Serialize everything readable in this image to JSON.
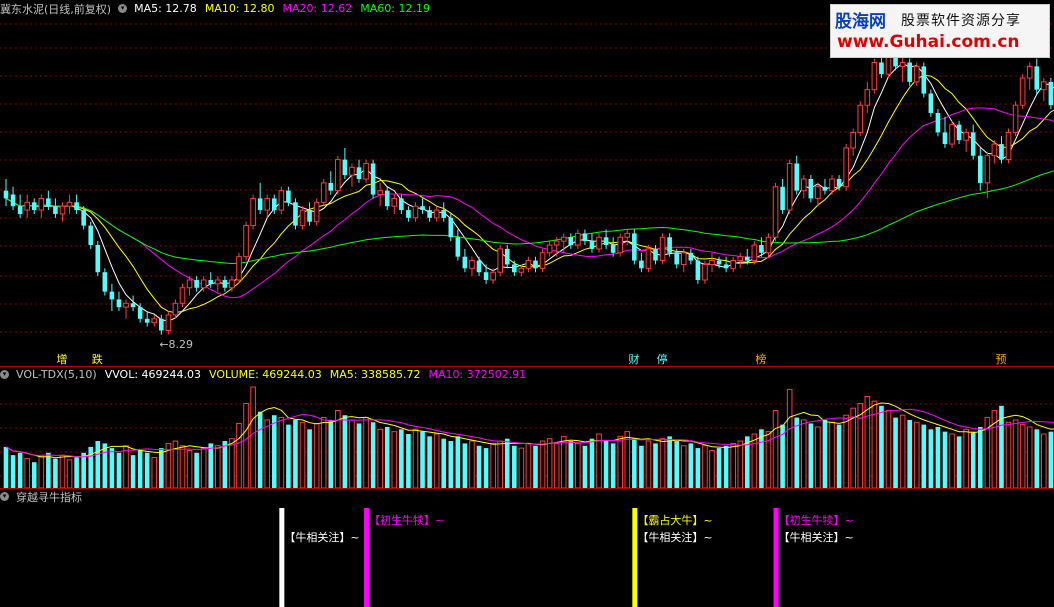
{
  "main_panel": {
    "title": "冀东水泥(日线,前复权)",
    "ma_labels": [
      {
        "text": "MA5: 12.78",
        "color": "#ffffff"
      },
      {
        "text": "MA10: 12.80",
        "color": "#ffff00"
      },
      {
        "text": "MA20: 12.62",
        "color": "#ff00ff"
      },
      {
        "text": "MA60: 12.19",
        "color": "#00ff00"
      }
    ],
    "low_annotation": "8.29",
    "events": [
      {
        "text": "增",
        "color": "#ffff00",
        "candle": 8
      },
      {
        "text": "跌",
        "color": "#ffff00",
        "candle": 13
      },
      {
        "text": "财",
        "color": "#54fcfc",
        "candle": 89
      },
      {
        "text": "停",
        "color": "#54fcfc",
        "candle": 93
      },
      {
        "text": "榜",
        "color": "#ffa500",
        "candle": 107
      },
      {
        "text": "预",
        "color": "#ffa500",
        "candle": 141
      }
    ]
  },
  "volume_panel": {
    "labels": [
      {
        "text": "VOL-TDX(5,10)",
        "color": "#c0c0c0"
      },
      {
        "text": "VVOL: 469244.03",
        "color": "#ffffff"
      },
      {
        "text": "VOLUME: 469244.03",
        "color": "#ffff00"
      },
      {
        "text": "MA5: 338585.72",
        "color": "#ffff00"
      },
      {
        "text": "MA10: 372502.91",
        "color": "#ff00ff"
      }
    ]
  },
  "signal_panel": {
    "title": "穿越寻牛指标",
    "signals": [
      {
        "candle": 39,
        "color": "#ffffff",
        "labels": [
          {
            "text": "【牛相关注】~",
            "color": "#ffffff",
            "row": 1
          }
        ]
      },
      {
        "candle": 51,
        "color": "#ff00ff",
        "labels": [
          {
            "text": "【初生牛犊】~",
            "color": "#ff00ff",
            "row": 0
          }
        ]
      },
      {
        "candle": 89,
        "color": "#ffff00",
        "labels": [
          {
            "text": "【霸占大牛】~",
            "color": "#ffff00",
            "row": 0
          },
          {
            "text": "【牛相关注】~",
            "color": "#ffffff",
            "row": 1
          }
        ]
      },
      {
        "candle": 109,
        "color": "#ff00ff",
        "labels": [
          {
            "text": "【初生牛犊】~",
            "color": "#ff00ff",
            "row": 0
          },
          {
            "text": "【牛相关注】~",
            "color": "#ffffff",
            "row": 1
          }
        ]
      }
    ]
  },
  "watermark": {
    "site": "股海网",
    "slogan": "股票软件资源分享",
    "url": "www.Guhai.com.cn"
  },
  "colors": {
    "up": "#ff3c3c",
    "down": "#54fcfc",
    "grid": "#8b0000",
    "ma5": "#ffffff",
    "ma10": "#ffff00",
    "ma20": "#ff00ff",
    "ma60": "#00ff00"
  },
  "chart_data": {
    "type": "candlestick",
    "candles": [
      [
        12.0,
        12.3,
        11.6,
        11.8
      ],
      [
        11.9,
        12.1,
        11.5,
        11.6
      ],
      [
        11.6,
        11.9,
        11.3,
        11.4
      ],
      [
        11.5,
        11.9,
        11.3,
        11.7
      ],
      [
        11.7,
        11.8,
        11.4,
        11.5
      ],
      [
        11.5,
        11.9,
        11.3,
        11.8
      ],
      [
        11.8,
        12.0,
        11.5,
        11.6
      ],
      [
        11.6,
        11.8,
        11.3,
        11.4
      ],
      [
        11.4,
        11.7,
        11.2,
        11.6
      ],
      [
        11.6,
        11.9,
        11.4,
        11.7
      ],
      [
        11.7,
        11.9,
        11.4,
        11.5
      ],
      [
        11.5,
        11.6,
        11.0,
        11.1
      ],
      [
        11.1,
        11.2,
        10.5,
        10.6
      ],
      [
        10.6,
        10.7,
        9.8,
        9.9
      ],
      [
        9.9,
        10.0,
        9.3,
        9.4
      ],
      [
        9.4,
        9.6,
        8.9,
        9.2
      ],
      [
        9.2,
        9.4,
        8.9,
        9.0
      ],
      [
        9.0,
        9.2,
        8.7,
        9.1
      ],
      [
        9.1,
        9.3,
        8.9,
        9.0
      ],
      [
        9.0,
        9.1,
        8.6,
        8.7
      ],
      [
        8.7,
        8.9,
        8.5,
        8.6
      ],
      [
        8.6,
        8.8,
        8.5,
        8.7
      ],
      [
        8.7,
        8.8,
        8.29,
        8.4
      ],
      [
        8.4,
        8.9,
        8.3,
        8.8
      ],
      [
        8.8,
        9.2,
        8.7,
        9.1
      ],
      [
        9.1,
        9.6,
        9.0,
        9.5
      ],
      [
        9.5,
        9.8,
        9.3,
        9.7
      ],
      [
        9.7,
        9.8,
        9.4,
        9.5
      ],
      [
        9.5,
        9.8,
        9.4,
        9.7
      ],
      [
        9.7,
        9.9,
        9.5,
        9.6
      ],
      [
        9.6,
        9.8,
        9.4,
        9.7
      ],
      [
        9.7,
        9.8,
        9.4,
        9.5
      ],
      [
        9.5,
        9.8,
        9.4,
        9.7
      ],
      [
        9.7,
        10.4,
        9.6,
        10.3
      ],
      [
        10.3,
        11.2,
        10.2,
        11.1
      ],
      [
        11.1,
        11.9,
        11.0,
        11.8
      ],
      [
        11.8,
        12.2,
        11.4,
        11.5
      ],
      [
        11.5,
        11.9,
        11.3,
        11.8
      ],
      [
        11.8,
        11.9,
        11.4,
        11.5
      ],
      [
        11.5,
        12.1,
        11.4,
        12.0
      ],
      [
        12.0,
        12.1,
        11.6,
        11.7
      ],
      [
        11.7,
        11.8,
        11.0,
        11.1
      ],
      [
        11.1,
        11.6,
        11.0,
        11.5
      ],
      [
        11.5,
        11.7,
        11.1,
        11.2
      ],
      [
        11.2,
        11.8,
        11.1,
        11.7
      ],
      [
        11.7,
        12.3,
        11.6,
        12.2
      ],
      [
        12.2,
        12.5,
        11.9,
        12.0
      ],
      [
        12.0,
        12.9,
        11.9,
        12.8
      ],
      [
        12.8,
        13.1,
        12.3,
        12.4
      ],
      [
        12.4,
        12.7,
        12.1,
        12.6
      ],
      [
        12.6,
        12.8,
        12.2,
        12.3
      ],
      [
        12.3,
        12.8,
        12.2,
        12.7
      ],
      [
        12.7,
        12.8,
        11.8,
        11.9
      ],
      [
        11.9,
        12.2,
        11.6,
        12.0
      ],
      [
        12.0,
        12.1,
        11.5,
        11.6
      ],
      [
        11.6,
        11.9,
        11.4,
        11.8
      ],
      [
        11.8,
        11.9,
        11.4,
        11.5
      ],
      [
        11.5,
        11.6,
        11.2,
        11.3
      ],
      [
        11.3,
        11.7,
        11.2,
        11.6
      ],
      [
        11.6,
        11.8,
        11.4,
        11.5
      ],
      [
        11.5,
        11.6,
        11.2,
        11.3
      ],
      [
        11.3,
        11.6,
        11.2,
        11.5
      ],
      [
        11.5,
        11.7,
        11.2,
        11.3
      ],
      [
        11.3,
        11.4,
        10.7,
        10.8
      ],
      [
        10.8,
        11.0,
        10.2,
        10.3
      ],
      [
        10.3,
        10.5,
        9.9,
        10.0
      ],
      [
        10.0,
        10.3,
        9.8,
        10.2
      ],
      [
        10.2,
        10.3,
        9.8,
        9.9
      ],
      [
        9.9,
        10.1,
        9.6,
        9.7
      ],
      [
        9.7,
        10.0,
        9.6,
        9.9
      ],
      [
        9.9,
        10.6,
        9.8,
        10.5
      ],
      [
        10.5,
        10.6,
        10.0,
        10.1
      ],
      [
        10.1,
        10.2,
        9.8,
        9.9
      ],
      [
        9.9,
        10.1,
        9.8,
        10.0
      ],
      [
        10.0,
        10.3,
        9.9,
        10.2
      ],
      [
        10.2,
        10.3,
        9.9,
        10.0
      ],
      [
        10.0,
        10.5,
        9.9,
        10.4
      ],
      [
        10.4,
        10.7,
        10.3,
        10.6
      ],
      [
        10.6,
        10.8,
        10.3,
        10.7
      ],
      [
        10.7,
        10.9,
        10.4,
        10.8
      ],
      [
        10.8,
        10.9,
        10.5,
        10.6
      ],
      [
        10.6,
        11.0,
        10.5,
        10.9
      ],
      [
        10.9,
        11.0,
        10.6,
        10.7
      ],
      [
        10.7,
        10.9,
        10.4,
        10.5
      ],
      [
        10.5,
        10.9,
        10.4,
        10.8
      ],
      [
        10.8,
        11.0,
        10.5,
        10.6
      ],
      [
        10.6,
        10.8,
        10.3,
        10.4
      ],
      [
        10.4,
        10.9,
        10.3,
        10.8
      ],
      [
        10.8,
        11.0,
        10.6,
        10.9
      ],
      [
        10.9,
        11.0,
        10.1,
        10.2
      ],
      [
        10.2,
        10.4,
        9.9,
        10.0
      ],
      [
        10.0,
        10.6,
        9.9,
        10.5
      ],
      [
        10.5,
        10.6,
        10.1,
        10.2
      ],
      [
        10.2,
        10.9,
        10.1,
        10.8
      ],
      [
        10.8,
        10.9,
        10.3,
        10.4
      ],
      [
        10.4,
        10.5,
        10.0,
        10.1
      ],
      [
        10.1,
        10.5,
        9.9,
        10.4
      ],
      [
        10.4,
        10.5,
        10.1,
        10.2
      ],
      [
        10.2,
        10.3,
        9.6,
        9.7
      ],
      [
        9.7,
        10.2,
        9.6,
        10.1
      ],
      [
        10.1,
        10.4,
        9.9,
        10.2
      ],
      [
        10.2,
        10.3,
        10.0,
        10.1
      ],
      [
        10.1,
        10.3,
        9.9,
        10.0
      ],
      [
        10.0,
        10.3,
        9.9,
        10.2
      ],
      [
        10.2,
        10.4,
        10.0,
        10.3
      ],
      [
        10.3,
        10.5,
        10.1,
        10.2
      ],
      [
        10.2,
        10.7,
        10.1,
        10.6
      ],
      [
        10.6,
        10.8,
        10.3,
        10.4
      ],
      [
        10.4,
        10.9,
        10.3,
        10.8
      ],
      [
        10.8,
        12.2,
        10.7,
        12.1
      ],
      [
        12.1,
        12.3,
        11.4,
        11.5
      ],
      [
        11.5,
        12.8,
        11.4,
        12.7
      ],
      [
        12.7,
        12.9,
        11.9,
        12.0
      ],
      [
        12.0,
        12.4,
        11.8,
        12.3
      ],
      [
        12.3,
        12.4,
        11.7,
        11.8
      ],
      [
        11.8,
        12.2,
        11.6,
        12.1
      ],
      [
        12.1,
        12.3,
        11.9,
        12.0
      ],
      [
        12.0,
        12.4,
        11.9,
        12.3
      ],
      [
        12.3,
        12.4,
        12.0,
        12.1
      ],
      [
        12.1,
        13.2,
        12.0,
        13.1
      ],
      [
        13.1,
        13.6,
        12.9,
        13.5
      ],
      [
        13.5,
        14.3,
        13.4,
        14.2
      ],
      [
        14.2,
        14.8,
        14.0,
        14.6
      ],
      [
        14.6,
        15.4,
        14.5,
        15.3
      ],
      [
        15.3,
        15.7,
        14.9,
        15.0
      ],
      [
        15.0,
        15.8,
        14.9,
        15.6
      ],
      [
        15.6,
        15.9,
        15.1,
        15.2
      ],
      [
        15.2,
        15.5,
        14.8,
        15.3
      ],
      [
        15.3,
        15.4,
        14.7,
        14.8
      ],
      [
        14.8,
        15.3,
        14.7,
        15.2
      ],
      [
        15.2,
        15.3,
        14.4,
        14.5
      ],
      [
        14.5,
        14.6,
        13.9,
        14.0
      ],
      [
        14.0,
        14.1,
        13.4,
        13.5
      ],
      [
        13.5,
        13.9,
        13.1,
        13.2
      ],
      [
        13.2,
        13.8,
        13.1,
        13.7
      ],
      [
        13.7,
        13.8,
        13.2,
        13.3
      ],
      [
        13.3,
        13.6,
        13.0,
        13.5
      ],
      [
        13.5,
        13.7,
        12.8,
        12.9
      ],
      [
        12.9,
        13.1,
        12.0,
        12.2
      ],
      [
        12.2,
        13.0,
        11.8,
        12.9
      ],
      [
        12.9,
        13.3,
        12.7,
        13.2
      ],
      [
        13.2,
        13.4,
        12.7,
        12.8
      ],
      [
        12.8,
        13.6,
        12.7,
        13.5
      ],
      [
        13.5,
        14.3,
        13.4,
        14.2
      ],
      [
        14.2,
        15.0,
        14.1,
        14.9
      ],
      [
        14.9,
        15.3,
        14.6,
        15.2
      ],
      [
        15.2,
        15.4,
        14.5,
        14.6
      ],
      [
        14.6,
        14.9,
        14.3,
        14.8
      ],
      [
        14.8,
        14.9,
        14.1,
        14.2
      ],
      [
        14.2,
        14.4,
        13.7,
        13.8
      ],
      [
        13.8,
        14.1,
        13.6,
        14.0
      ],
      [
        14.0,
        14.2,
        13.7,
        13.8
      ],
      [
        13.8,
        14.1,
        13.5,
        13.6
      ],
      [
        13.6,
        14.4,
        13.5,
        14.3
      ],
      [
        14.3,
        15.2,
        14.2,
        15.1
      ]
    ],
    "volume": [
      35,
      28,
      30,
      25,
      22,
      27,
      30,
      25,
      28,
      24,
      26,
      30,
      35,
      40,
      38,
      34,
      30,
      36,
      28,
      32,
      30,
      26,
      34,
      38,
      40,
      36,
      32,
      30,
      34,
      38,
      36,
      40,
      42,
      55,
      72,
      86,
      65,
      58,
      62,
      60,
      54,
      58,
      56,
      50,
      55,
      60,
      58,
      66,
      62,
      58,
      55,
      60,
      56,
      50,
      52,
      48,
      50,
      46,
      50,
      48,
      44,
      46,
      42,
      40,
      44,
      38,
      40,
      36,
      34,
      38,
      40,
      42,
      36,
      34,
      38,
      36,
      40,
      42,
      38,
      44,
      40,
      38,
      36,
      42,
      46,
      40,
      38,
      44,
      48,
      42,
      36,
      40,
      38,
      42,
      44,
      40,
      36,
      38,
      34,
      36,
      32,
      34,
      36,
      38,
      40,
      44,
      46,
      50,
      48,
      66,
      54,
      84,
      60,
      58,
      55,
      52,
      58,
      56,
      54,
      62,
      68,
      72,
      78,
      74,
      70,
      66,
      60,
      62,
      58,
      56,
      54,
      50,
      52,
      48,
      46,
      44,
      50,
      48,
      52,
      60,
      66,
      70,
      56,
      58,
      54,
      52,
      50,
      46,
      48,
      58,
      62
    ],
    "volume_unit": "10k"
  }
}
